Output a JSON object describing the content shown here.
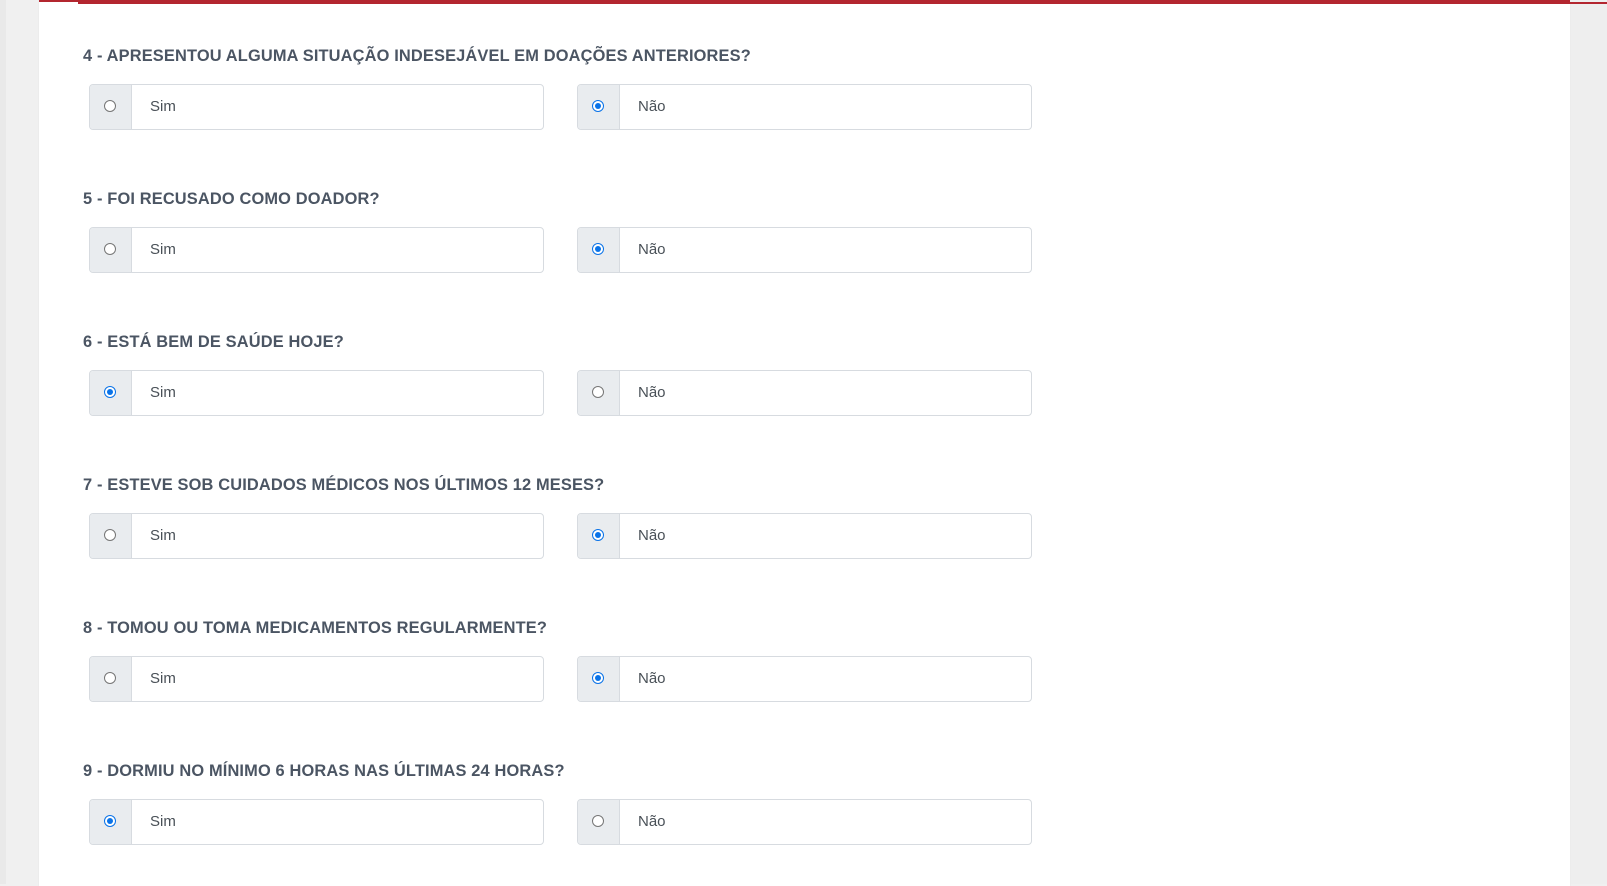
{
  "questions": [
    {
      "title": "4 - APRESENTOU ALGUMA SITUAÇÃO INDESEJÁVEL EM DOAÇÕES ANTERIORES?",
      "options": [
        {
          "label": "Sim",
          "checked": false
        },
        {
          "label": "Não",
          "checked": true
        }
      ]
    },
    {
      "title": "5 - FOI RECUSADO COMO DOADOR?",
      "options": [
        {
          "label": "Sim",
          "checked": false
        },
        {
          "label": "Não",
          "checked": true
        }
      ]
    },
    {
      "title": "6 - ESTÁ BEM DE SAÚDE HOJE?",
      "options": [
        {
          "label": "Sim",
          "checked": true
        },
        {
          "label": "Não",
          "checked": false
        }
      ]
    },
    {
      "title": "7 - ESTEVE SOB CUIDADOS MÉDICOS NOS ÚLTIMOS 12 MESES?",
      "options": [
        {
          "label": "Sim",
          "checked": false
        },
        {
          "label": "Não",
          "checked": true
        }
      ]
    },
    {
      "title": "8 - TOMOU OU TOMA MEDICAMENTOS REGULARMENTE?",
      "options": [
        {
          "label": "Sim",
          "checked": false
        },
        {
          "label": "Não",
          "checked": true
        }
      ]
    },
    {
      "title": "9 - DORMIU NO MÍNIMO 6 HORAS NAS ÚLTIMAS 24 HORAS?",
      "options": [
        {
          "label": "Sim",
          "checked": true
        },
        {
          "label": "Não",
          "checked": false
        }
      ]
    }
  ],
  "colors": {
    "accent_red": "#b3262f",
    "radio_blue": "#0a73e8",
    "title_text": "#4b5563",
    "radio_cell_bg": "#e9ecef"
  }
}
